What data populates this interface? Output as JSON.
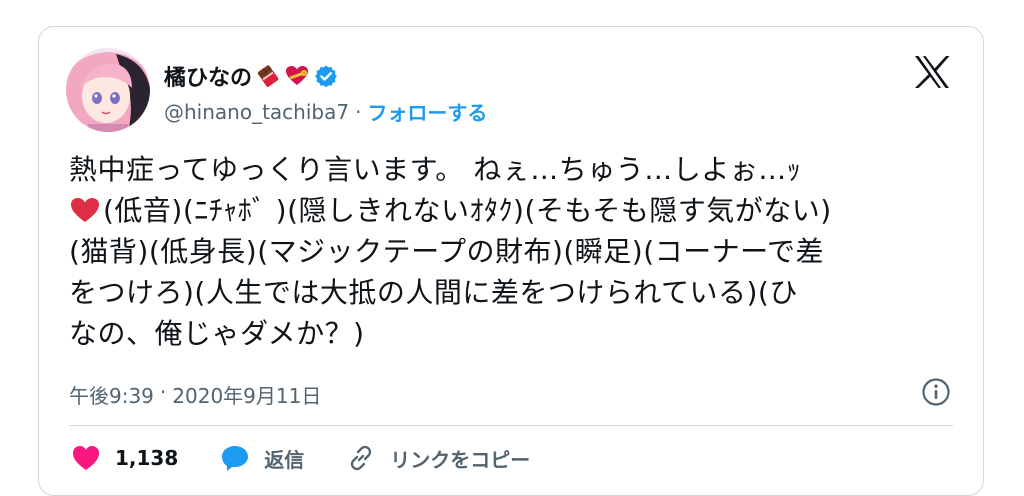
{
  "user": {
    "display_name": "橘ひなの",
    "handle": "@hinano_tachiba7",
    "separator": "·",
    "follow_label": "フォローする"
  },
  "tweet": {
    "lines": [
      "熱中症ってゆっくり言います。 ねぇ…ちゅう…しよぉ…ｯ",
      "(低音)(ﾆﾁｬﾎﾞ )(隠しきれないｵﾀｸ)(そもそも隠す気がない)",
      "(猫背)(低身長)(マジックテープの財布)(瞬足)(コーナーで差",
      "をつけろ)(人生では大抵の人間に差をつけられている)(ひ",
      "なの、俺じゃダメか？)"
    ],
    "time": "午後9:39",
    "date_separator": "·",
    "date": "2020年9月11日"
  },
  "actions": {
    "like_count": "1,138",
    "reply_label": "返信",
    "copy_link_label": "リンクをコピー"
  },
  "colors": {
    "accent": "#1d9bf0",
    "like": "#f91880",
    "text": "#0f1419",
    "muted": "#536471",
    "border": "#cfd9de"
  }
}
